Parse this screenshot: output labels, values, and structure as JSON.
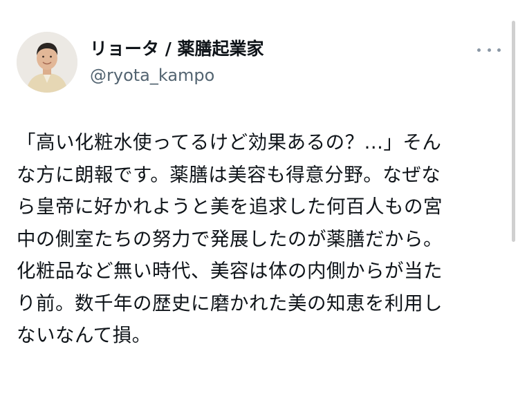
{
  "author": {
    "display_name": "リョータ / 薬膳起業家",
    "handle": "@ryota_kampo",
    "avatar_icon": "avatar-photo-icon"
  },
  "menu": {
    "more_icon": "more-options-icon"
  },
  "tweet": {
    "text": "「高い化粧水使ってるけど効果あるの？...」そん\nな方に朗報です。薬膳は美容も得意分野。なぜな\nら皇帝に好かれようと美を追求した何百人もの宮\n中の側室たちの努力で発展したのが薬膳だから。\n化粧品など無い時代、美容は体の内側からが当た\nり前。数千年の歴史に磨かれた美の知恵を利用し\nないなんて損。"
  },
  "colors": {
    "text": "#0f1419",
    "secondary_text": "#536471",
    "icon_gray": "#8b98a5",
    "background": "#ffffff"
  }
}
